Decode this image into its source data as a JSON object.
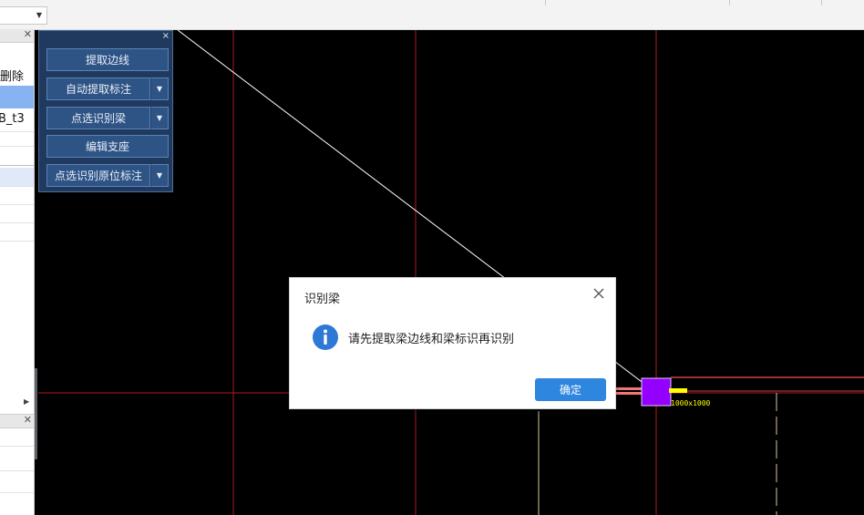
{
  "toolbar": {
    "combo_value": ""
  },
  "left_panel": {
    "texts": [
      "删除",
      "B_t3"
    ]
  },
  "palette": {
    "close_glyph": "×",
    "buttons": [
      {
        "label": "提取边线",
        "has_dropdown": false
      },
      {
        "label": "自动提取标注",
        "has_dropdown": true
      },
      {
        "label": "点选识别梁",
        "has_dropdown": true
      },
      {
        "label": "编辑支座",
        "has_dropdown": false
      },
      {
        "label": "点选识别原位标注",
        "has_dropdown": true
      }
    ]
  },
  "canvas": {
    "annotations": [
      "1000x1000"
    ],
    "colors": {
      "grid": "#b01a1a",
      "beam": "#f07878",
      "column": "#9400ff",
      "label": "#ffff00"
    }
  },
  "dialog": {
    "title": "识别梁",
    "message": "请先提取梁边线和梁标识再识别",
    "ok_label": "确定",
    "icon": "info-icon"
  }
}
